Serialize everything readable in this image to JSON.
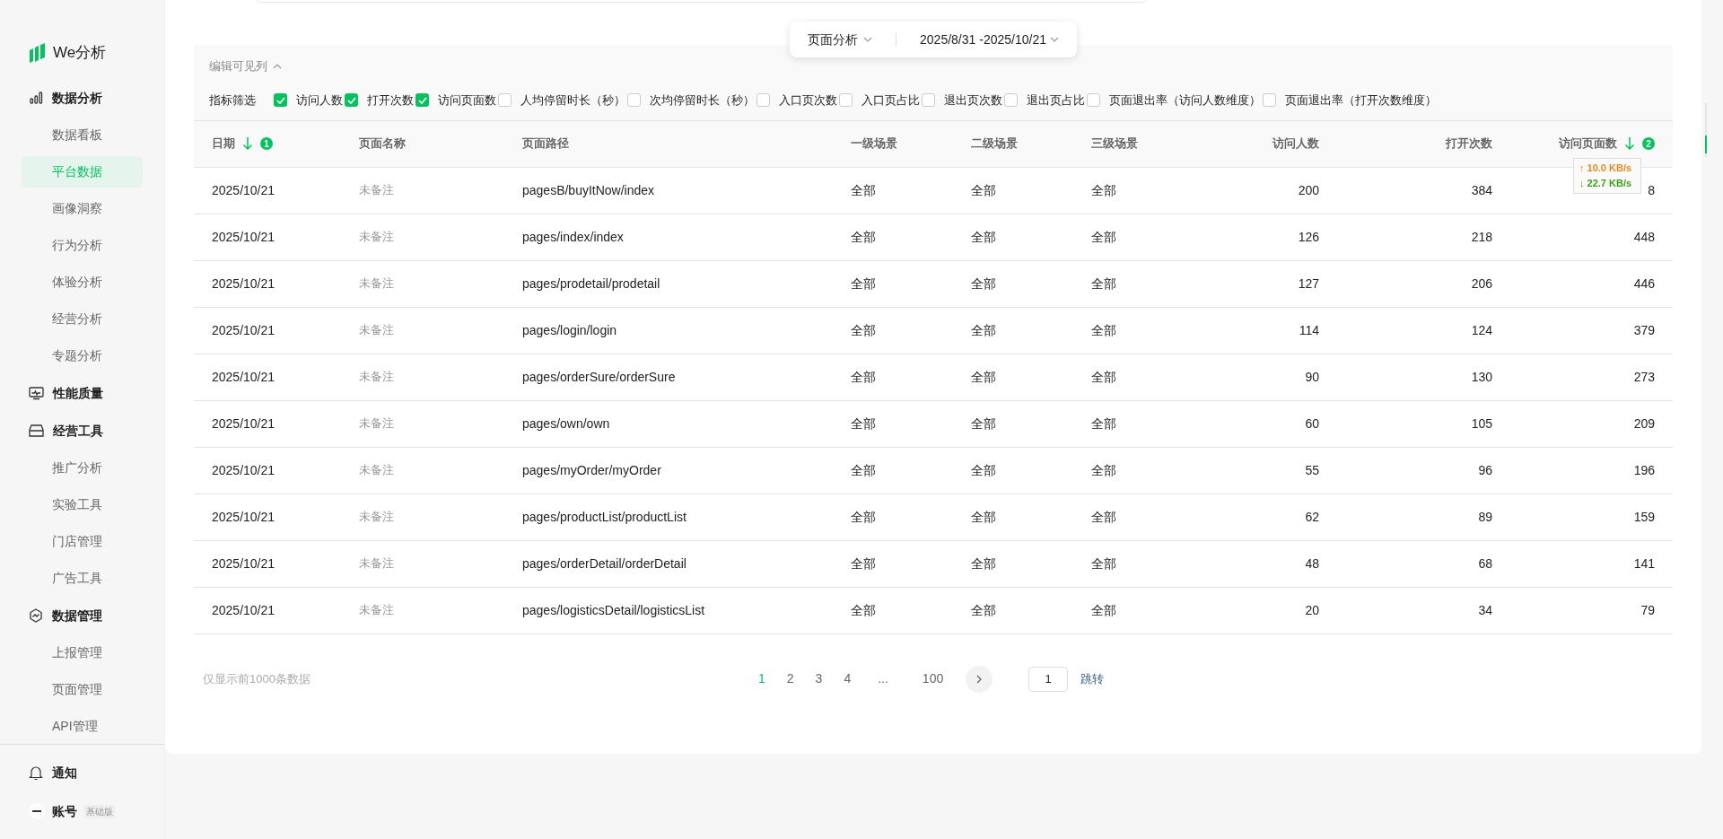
{
  "sidebar": {
    "logo": "We分析",
    "items": [
      {
        "kind": "group",
        "label": "数据分析",
        "selected": false
      },
      {
        "kind": "item",
        "label": "数据看板",
        "selected": false
      },
      {
        "kind": "item",
        "label": "平台数据",
        "selected": true
      },
      {
        "kind": "item",
        "label": "画像洞察",
        "selected": false
      },
      {
        "kind": "item",
        "label": "行为分析",
        "selected": false
      },
      {
        "kind": "item",
        "label": "体验分析",
        "selected": false
      },
      {
        "kind": "item",
        "label": "经营分析",
        "selected": false
      },
      {
        "kind": "item",
        "label": "专题分析",
        "selected": false
      },
      {
        "kind": "group",
        "label": "性能质量",
        "selected": false
      },
      {
        "kind": "group",
        "label": "经营工具",
        "selected": false
      },
      {
        "kind": "item",
        "label": "推广分析",
        "selected": false
      },
      {
        "kind": "item",
        "label": "实验工具",
        "selected": false
      },
      {
        "kind": "item",
        "label": "门店管理",
        "selected": false
      },
      {
        "kind": "item",
        "label": "广告工具",
        "selected": false
      },
      {
        "kind": "group",
        "label": "数据管理",
        "selected": false
      },
      {
        "kind": "item",
        "label": "上报管理",
        "selected": false
      },
      {
        "kind": "item",
        "label": "页面管理",
        "selected": false
      },
      {
        "kind": "item",
        "label": "API管理",
        "selected": false
      }
    ],
    "notice": "通知",
    "account": {
      "label": "账号",
      "badge": "基础版"
    }
  },
  "toolbar": {
    "analysis": "页面分析",
    "date_range": "2025/8/31 -2025/10/21"
  },
  "columns_panel": {
    "title": "编辑可见列",
    "filter_label": "指标筛选",
    "metrics": [
      {
        "label": "访问人数",
        "checked": true
      },
      {
        "label": "打开次数",
        "checked": true
      },
      {
        "label": "访问页面数",
        "checked": true
      },
      {
        "label": "人均停留时长（秒）",
        "checked": false
      },
      {
        "label": "次均停留时长（秒）",
        "checked": false
      },
      {
        "label": "入口页次数",
        "checked": false
      },
      {
        "label": "入口页占比",
        "checked": false
      },
      {
        "label": "退出页次数",
        "checked": false
      },
      {
        "label": "退出页占比",
        "checked": false
      },
      {
        "label": "页面退出率（访问人数维度）",
        "checked": false
      },
      {
        "label": "页面退出率（打开次数维度）",
        "checked": false
      }
    ]
  },
  "table": {
    "columns": [
      {
        "label": "日期",
        "sort": "1"
      },
      {
        "label": "页面名称"
      },
      {
        "label": "页面路径"
      },
      {
        "label": "一级场景"
      },
      {
        "label": "二级场景"
      },
      {
        "label": "三级场景"
      },
      {
        "label": "访问人数"
      },
      {
        "label": "打开次数"
      },
      {
        "label": "访问页面数",
        "sort": "2"
      }
    ],
    "rows": [
      [
        "2025/10/21",
        "未备注",
        "pagesB/buyItNow/index",
        "全部",
        "全部",
        "全部",
        "200",
        "384",
        "8"
      ],
      [
        "2025/10/21",
        "未备注",
        "pages/index/index",
        "全部",
        "全部",
        "全部",
        "126",
        "218",
        "448"
      ],
      [
        "2025/10/21",
        "未备注",
        "pages/prodetail/prodetail",
        "全部",
        "全部",
        "全部",
        "127",
        "206",
        "446"
      ],
      [
        "2025/10/21",
        "未备注",
        "pages/login/login",
        "全部",
        "全部",
        "全部",
        "114",
        "124",
        "379"
      ],
      [
        "2025/10/21",
        "未备注",
        "pages/orderSure/orderSure",
        "全部",
        "全部",
        "全部",
        "90",
        "130",
        "273"
      ],
      [
        "2025/10/21",
        "未备注",
        "pages/own/own",
        "全部",
        "全部",
        "全部",
        "60",
        "105",
        "209"
      ],
      [
        "2025/10/21",
        "未备注",
        "pages/myOrder/myOrder",
        "全部",
        "全部",
        "全部",
        "55",
        "96",
        "196"
      ],
      [
        "2025/10/21",
        "未备注",
        "pages/productList/productList",
        "全部",
        "全部",
        "全部",
        "62",
        "89",
        "159"
      ],
      [
        "2025/10/21",
        "未备注",
        "pages/orderDetail/orderDetail",
        "全部",
        "全部",
        "全部",
        "48",
        "68",
        "141"
      ],
      [
        "2025/10/21",
        "未备注",
        "pages/logisticsDetail/logisticsList",
        "全部",
        "全部",
        "全部",
        "20",
        "34",
        "79"
      ]
    ]
  },
  "footer": {
    "note": "仅显示前1000条数据",
    "pages": [
      {
        "label": "1",
        "selected": true
      },
      {
        "label": "2",
        "selected": false
      },
      {
        "label": "3",
        "selected": false
      },
      {
        "label": "4",
        "selected": false
      },
      {
        "label": "...",
        "selected": false
      },
      {
        "label": "100",
        "selected": false
      }
    ],
    "page_input": "1",
    "jump": "跳转"
  },
  "speed_badge": {
    "up": "↑ 10.0 KB/s",
    "down": "↓ 22.7 KB/s"
  }
}
